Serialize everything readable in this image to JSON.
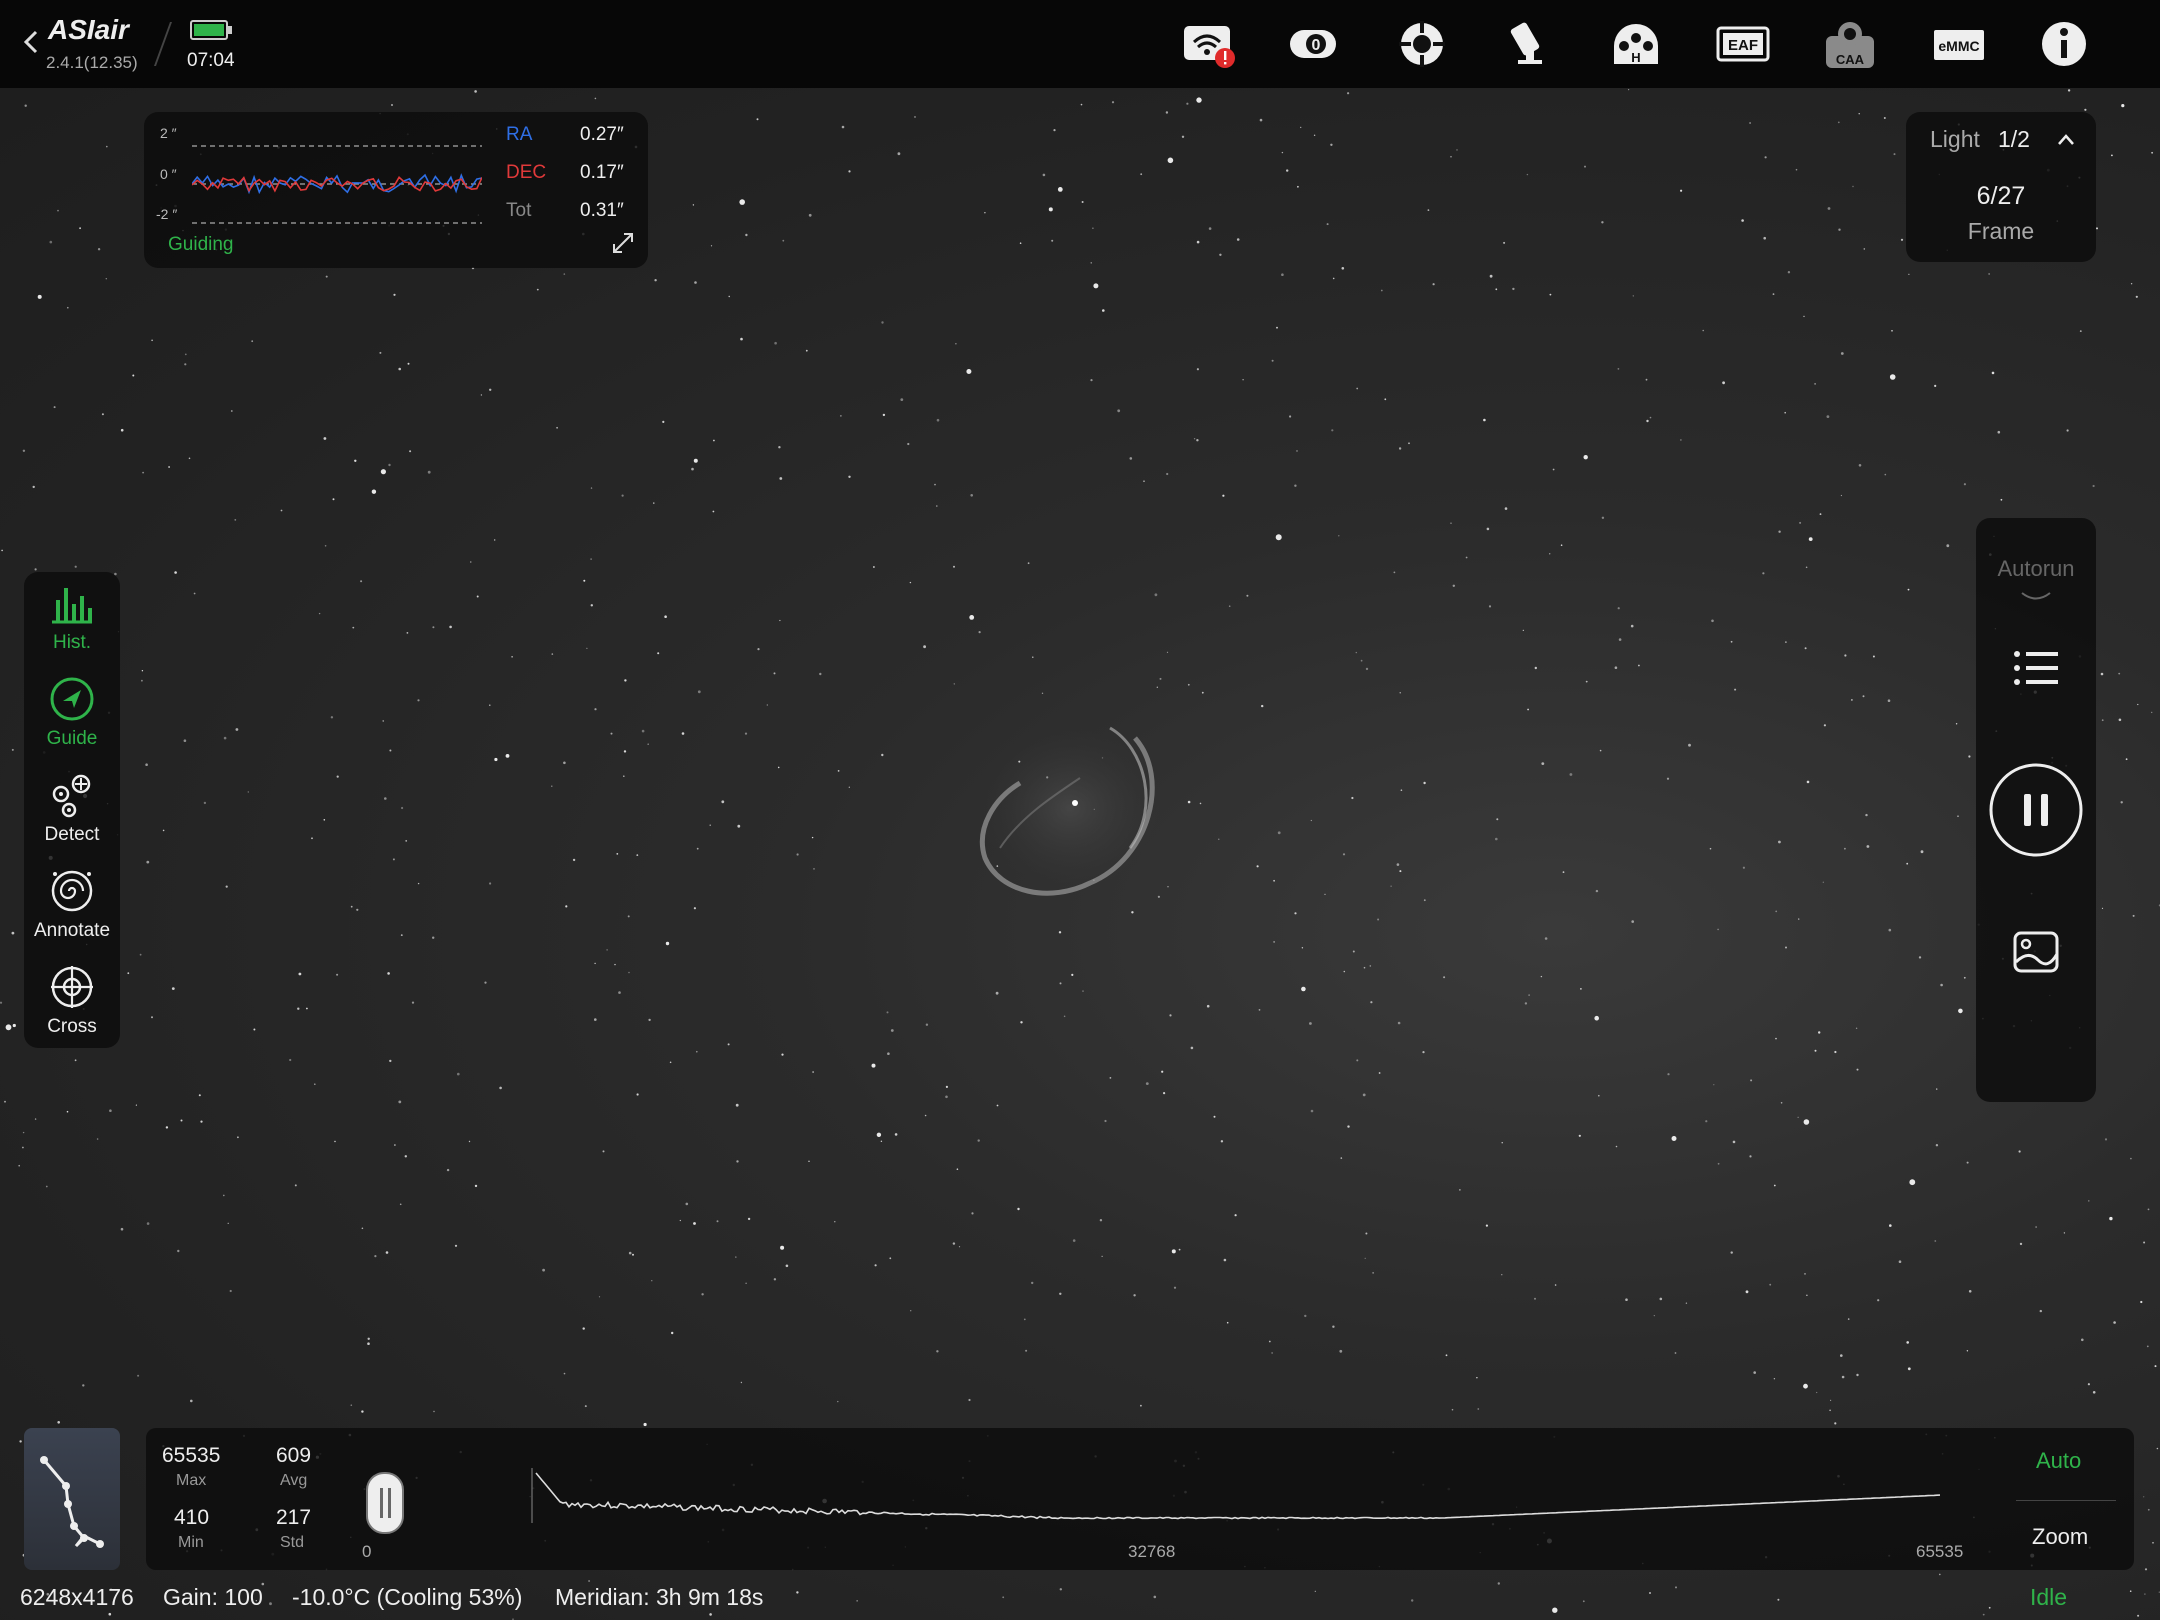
{
  "app": {
    "logo_text": "ASIair",
    "version": "2.4.1(12.35)",
    "time": "07:04",
    "battery_color": "#2fb34a"
  },
  "top_icons": [
    "wifi-alert-icon",
    "camera-icon",
    "focus-crosshair-icon",
    "telescope-mount-icon",
    "filter-wheel-icon",
    "eaf-icon",
    "caa-icon",
    "emmc-icon",
    "info-icon"
  ],
  "top_icon_texts": {
    "filter": "H",
    "eaf": "EAF",
    "caa": "CAA",
    "emmc": "eMMC"
  },
  "guide_panel": {
    "y_labels": [
      "2 ″",
      "0 ″",
      "-2 ″"
    ],
    "ra_label": "RA",
    "ra_value": "0.27″",
    "dec_label": "DEC",
    "dec_value": "0.17″",
    "tot_label": "Tot",
    "tot_value": "0.31″",
    "status": "Guiding",
    "ra_color": "#2f6fe6",
    "dec_color": "#e0393a"
  },
  "light_panel": {
    "label": "Light",
    "counter": "1/2",
    "frame_count": "6/27",
    "frame_label": "Frame"
  },
  "left_tools": [
    {
      "name": "hist",
      "label": "Hist.",
      "active": true
    },
    {
      "name": "guide",
      "label": "Guide",
      "active": true
    },
    {
      "name": "detect",
      "label": "Detect",
      "active": false
    },
    {
      "name": "annotate",
      "label": "Annotate",
      "active": false
    },
    {
      "name": "cross",
      "label": "Cross",
      "active": false
    }
  ],
  "right_panel": {
    "autorun_label": "Autorun"
  },
  "histogram": {
    "max_value": "65535",
    "max_label": "Max",
    "avg_value": "609",
    "avg_label": "Avg",
    "min_value": "410",
    "min_label": "Min",
    "std_value": "217",
    "std_label": "Std",
    "axis_ticks": [
      "0",
      "32768",
      "65535"
    ],
    "auto_label": "Auto",
    "zoom_label": "Zoom"
  },
  "status_bar": {
    "resolution": "6248x4176",
    "gain": "Gain: 100",
    "temperature": "-10.0°C (Cooling 53%)",
    "meridian": "Meridian: 3h 9m 18s",
    "state": "Idle"
  }
}
